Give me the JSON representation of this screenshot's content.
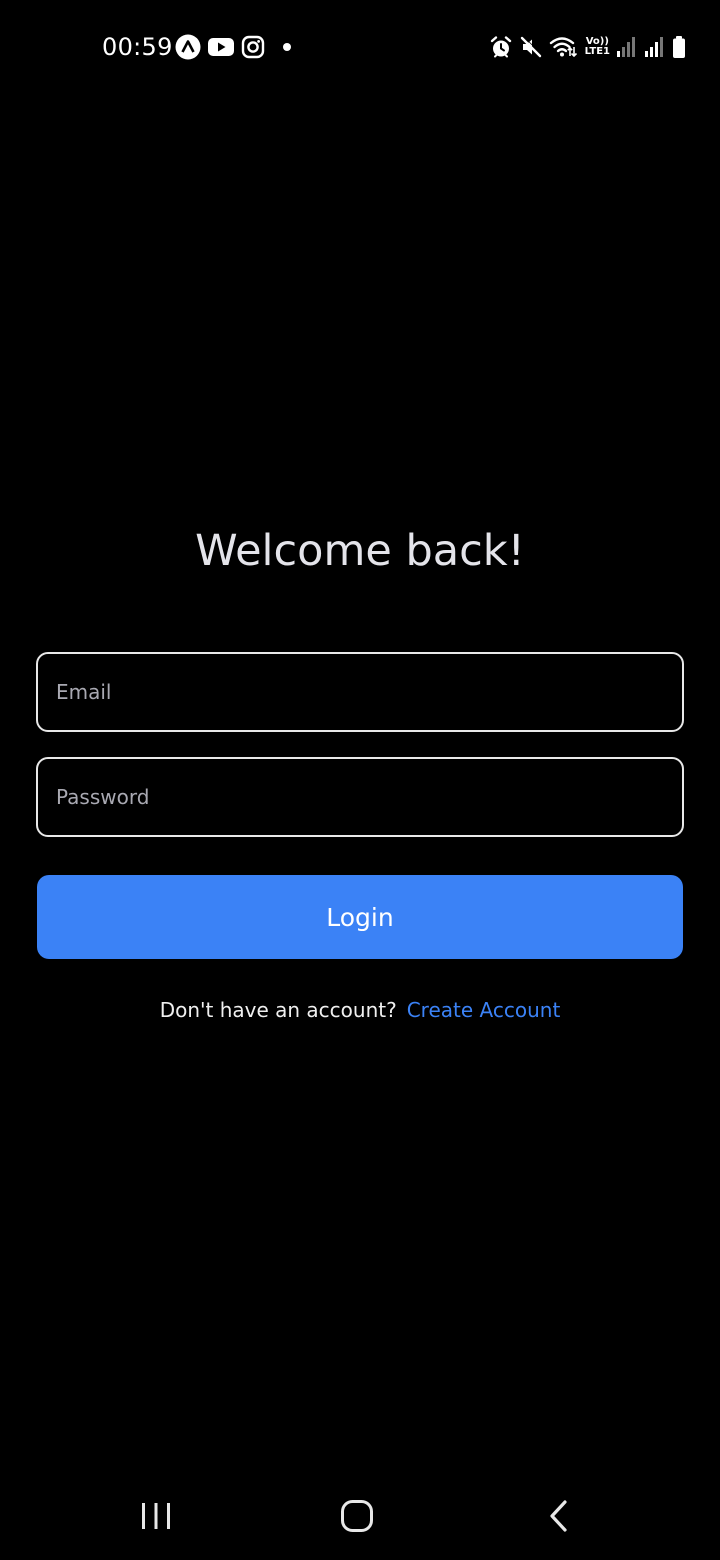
{
  "status_bar": {
    "time": "00:59",
    "left_icons": [
      "app-a-icon",
      "youtube-icon",
      "instagram-icon",
      "notification-dot-icon"
    ],
    "right_icons": [
      "alarm-icon",
      "mute-icon",
      "wifi-icon",
      "volte-icon",
      "signal-icon",
      "signal-icon",
      "battery-icon"
    ],
    "volte_top": "Vo))",
    "volte_bottom": "LTE1"
  },
  "login": {
    "title": "Welcome back!",
    "email_placeholder": "Email",
    "email_value": "",
    "password_placeholder": "Password",
    "password_value": "",
    "login_label": "Login",
    "signup_prompt": "Don't have an account?",
    "signup_link": "Create Account"
  },
  "nav_bar": {
    "items": [
      "recents-icon",
      "home-icon",
      "back-icon"
    ]
  },
  "colors": {
    "background": "#000000",
    "accent": "#3b82f6",
    "title": "#e4e4ea",
    "field_border": "#e8e8e8",
    "placeholder": "#a9a9b2"
  }
}
